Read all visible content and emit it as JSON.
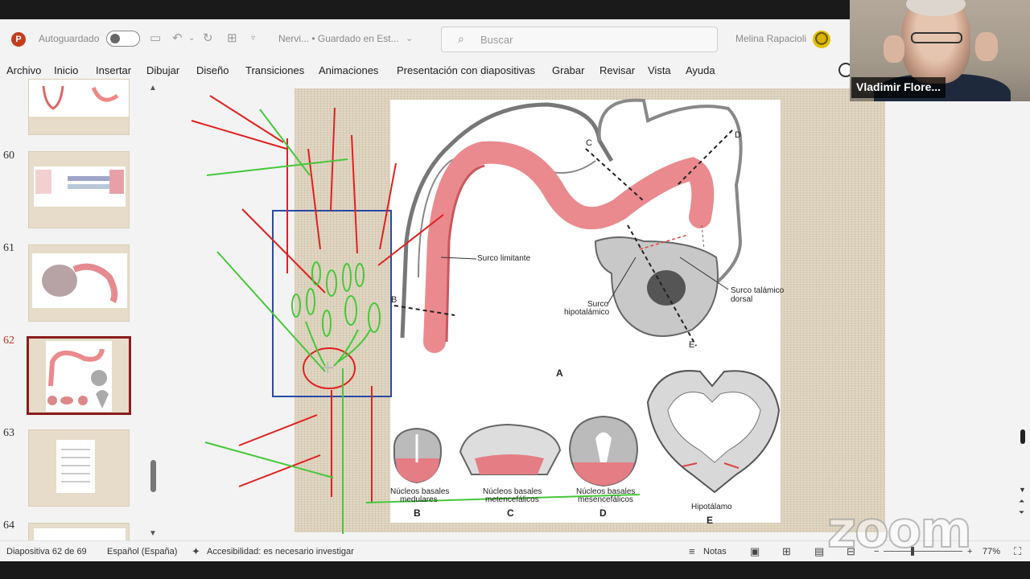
{
  "titlebar": {
    "autosave_label": "Autoguardado",
    "doc_status": "Nervi... • Guardado en Est...",
    "search_placeholder": "Buscar",
    "user_name": "Melina Rapacioli"
  },
  "menu": [
    "Archivo",
    "Inicio",
    "Insertar",
    "Dibujar",
    "Diseño",
    "Transiciones",
    "Animaciones",
    "Presentación con diapositivas",
    "Grabar",
    "Revisar",
    "Vista",
    "Ayuda"
  ],
  "slides": [
    {
      "number": "60"
    },
    {
      "number": "61"
    },
    {
      "number": "62",
      "selected": true
    },
    {
      "number": "63"
    },
    {
      "number": "64"
    }
  ],
  "diagram": {
    "labels": {
      "surco_limitante": "Surco limitante",
      "surco_hipotalamico_1": "Surco",
      "surco_hipotalamico_2": "hipotalámico",
      "surco_talamico_1": "Surco talámico",
      "surco_talamico_2": "dorsal",
      "nucleos_medulares_1": "Núcleos basales",
      "nucleos_medulares_2": "medulares",
      "nucleos_metenc_1": "Núcleos basales",
      "nucleos_metenc_2": "metencefálicos",
      "nucleos_mesenc_1": "Núcleos basales",
      "nucleos_mesenc_2": "mesencefálicos",
      "hipotalamo": "Hipotálamo"
    },
    "letters": {
      "A": "A",
      "B": "B",
      "C": "C",
      "D": "D",
      "E": "E",
      "B_line": "B",
      "C_line": "C",
      "D_line": "D",
      "E_line": "E"
    }
  },
  "video": {
    "participant_name": "Vladimir Flore..."
  },
  "statusbar": {
    "slide_info": "Diapositiva 62 de 69",
    "language": "Español (España)",
    "accessibility": "Accesibilidad: es necesario investigar",
    "notes": "Notas",
    "zoom": "77%"
  },
  "watermark": "zoom",
  "colors": {
    "accent_red": "#c43e1c",
    "pen_red": "#e02020",
    "pen_green": "#45c83a",
    "pen_blue": "#2a4aa8",
    "neural_pink": "#ea8a8e"
  }
}
